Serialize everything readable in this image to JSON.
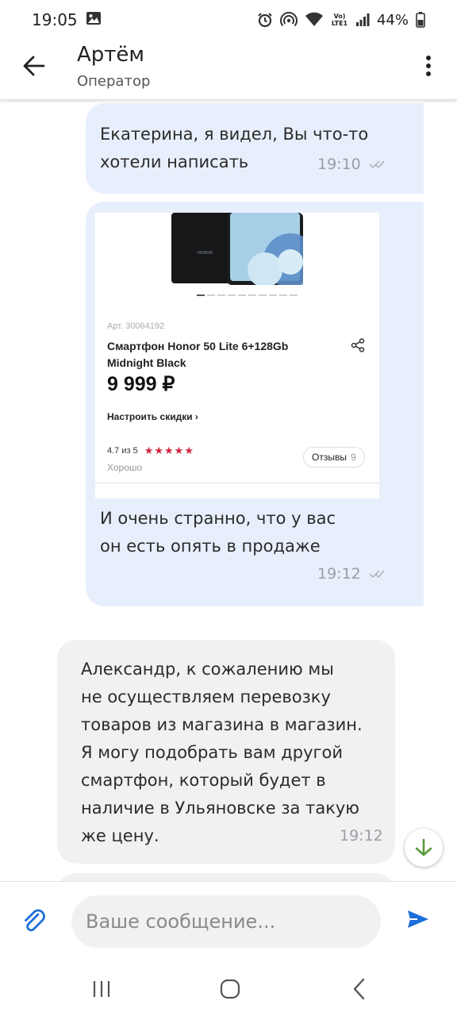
{
  "status_bar": {
    "time": "19:05",
    "network_label": "Vo) LTE1",
    "battery": "44%"
  },
  "header": {
    "name": "Артём",
    "role": "Оператор"
  },
  "messages": [
    {
      "direction": "outgoing",
      "text": "Екатерина, я видел, Вы что-то\nхотели написать",
      "time": "19:10"
    },
    {
      "direction": "outgoing",
      "product": {
        "article": "Арт. 30064192",
        "name": "Смартфон Honor 50 Lite 6+128Gb Midnight Black",
        "brand_on_phone": "HONOR",
        "price": "9 999 ₽",
        "discount_link": "Настроить скидки ›",
        "rating": "4.7 из 5",
        "rating_stars": "★★★★★",
        "rating_word": "Хорошо",
        "reviews_label": "Отзывы",
        "reviews_count": "9"
      },
      "text": "И очень странно, что у вас\nон есть опять в продаже",
      "time": "19:12"
    },
    {
      "direction": "incoming",
      "text": "Александр, к сожалению мы\nне осуществляем перевозку\nтоваров из магазина в магазин.\nЯ могу подобрать вам другой\nсмартфон, который будет в\nналичие в Ульяновске за такую\nже цену.",
      "time": "19:12"
    }
  ],
  "composer": {
    "placeholder": "Ваше сообщение..."
  },
  "colors": {
    "outgoing_bubble": "#e8effc",
    "incoming_bubble": "#f1f1f1",
    "accent_blue": "#1e6fd9",
    "scroll_arrow_green": "#5a9a3a",
    "rating_red": "#d6243f"
  }
}
